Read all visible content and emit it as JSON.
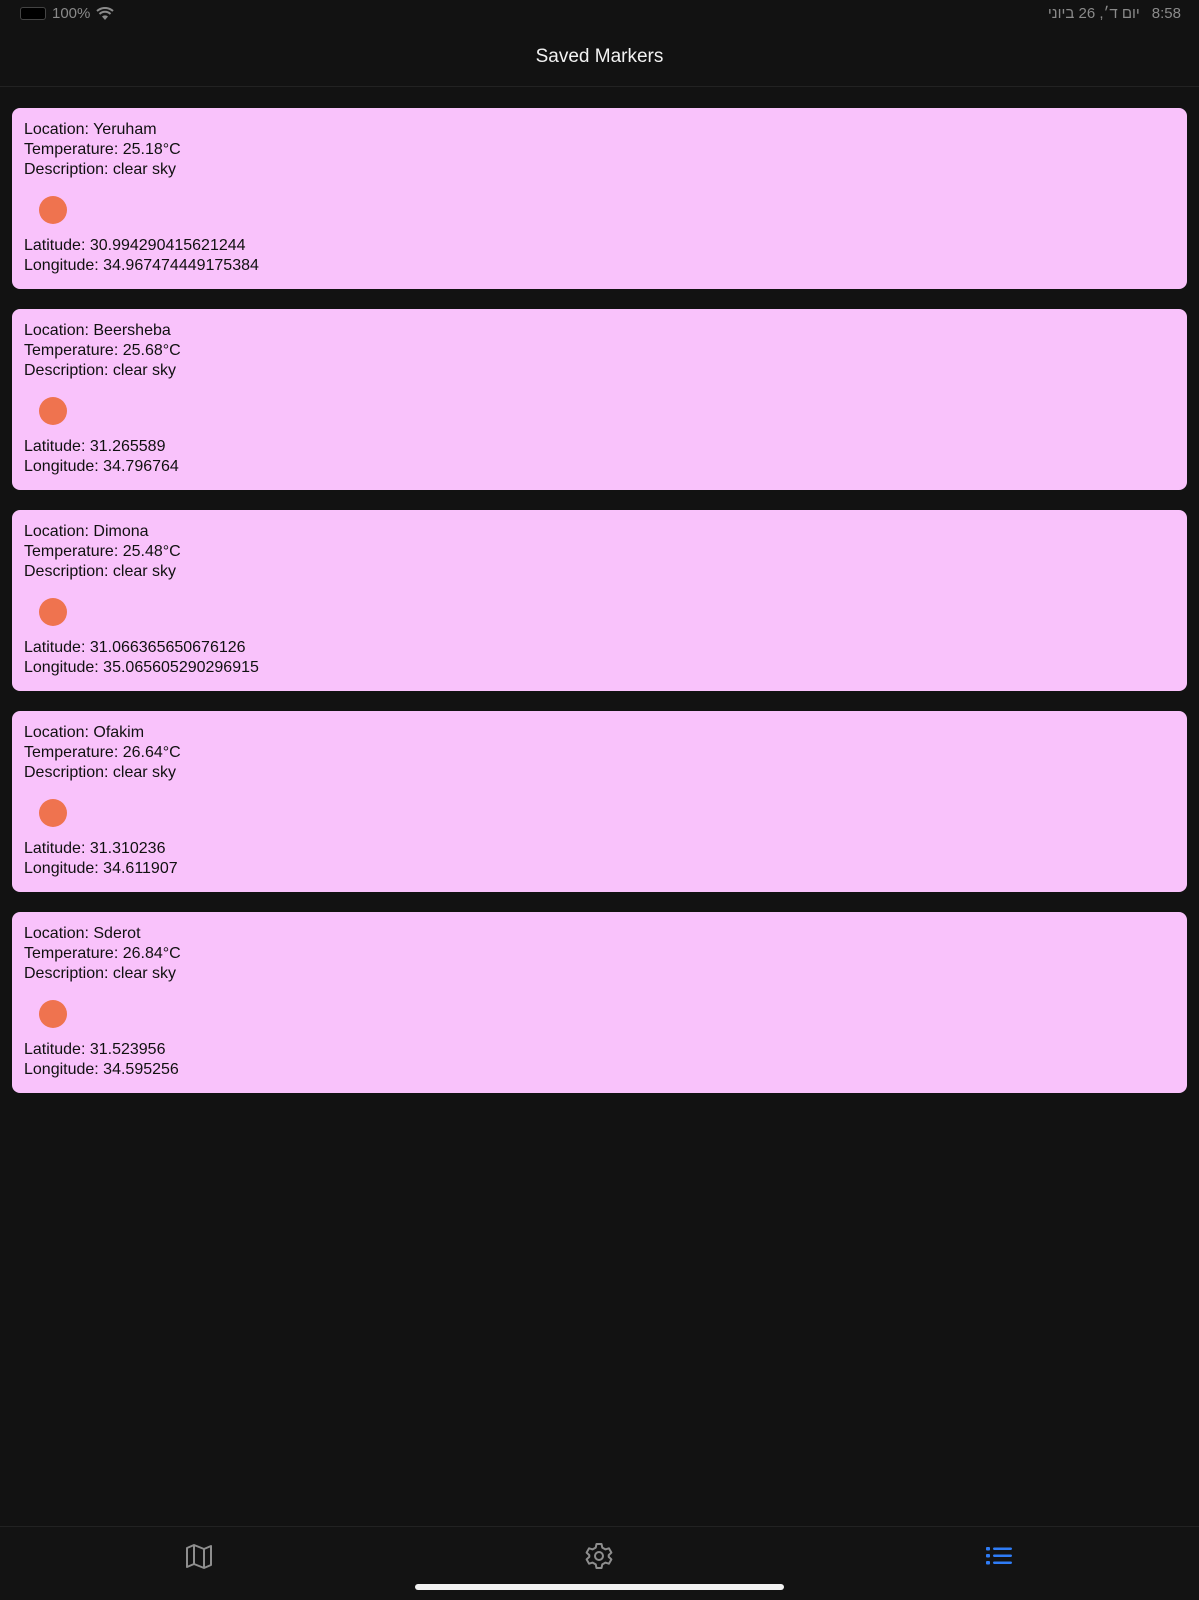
{
  "status_bar": {
    "battery": "100%",
    "date": "יום ד׳, 26 ביוני",
    "time": "8:58"
  },
  "nav": {
    "title": "Saved Markers"
  },
  "markers": [
    {
      "location": "Location: Yeruham",
      "temperature": "Temperature: 25.18°C",
      "description": "Description: clear sky",
      "latitude": "Latitude: 30.994290415621244",
      "longitude": "Longitude: 34.967474449175384"
    },
    {
      "location": "Location: Beersheba",
      "temperature": "Temperature: 25.68°C",
      "description": "Description: clear sky",
      "latitude": "Latitude: 31.265589",
      "longitude": "Longitude: 34.796764"
    },
    {
      "location": "Location: Dimona",
      "temperature": "Temperature: 25.48°C",
      "description": "Description: clear sky",
      "latitude": "Latitude: 31.066365650676126",
      "longitude": "Longitude: 35.065605290296915"
    },
    {
      "location": "Location: Ofakim",
      "temperature": "Temperature: 26.64°C",
      "description": "Description: clear sky",
      "latitude": "Latitude: 31.310236",
      "longitude": "Longitude: 34.611907"
    },
    {
      "location": "Location: Sderot",
      "temperature": "Temperature: 26.84°C",
      "description": "Description: clear sky",
      "latitude": "Latitude: 31.523956",
      "longitude": "Longitude: 34.595256"
    }
  ],
  "tabs": [
    {
      "icon": "map-icon",
      "active": false
    },
    {
      "icon": "gear-icon",
      "active": false
    },
    {
      "icon": "list-icon",
      "active": true
    }
  ],
  "colors": {
    "background": "#121212",
    "card": "#f9c2fb",
    "marker_dot": "#ef734f",
    "tab_active": "#2f7cf6",
    "tab_inactive": "#8e8e8e"
  }
}
